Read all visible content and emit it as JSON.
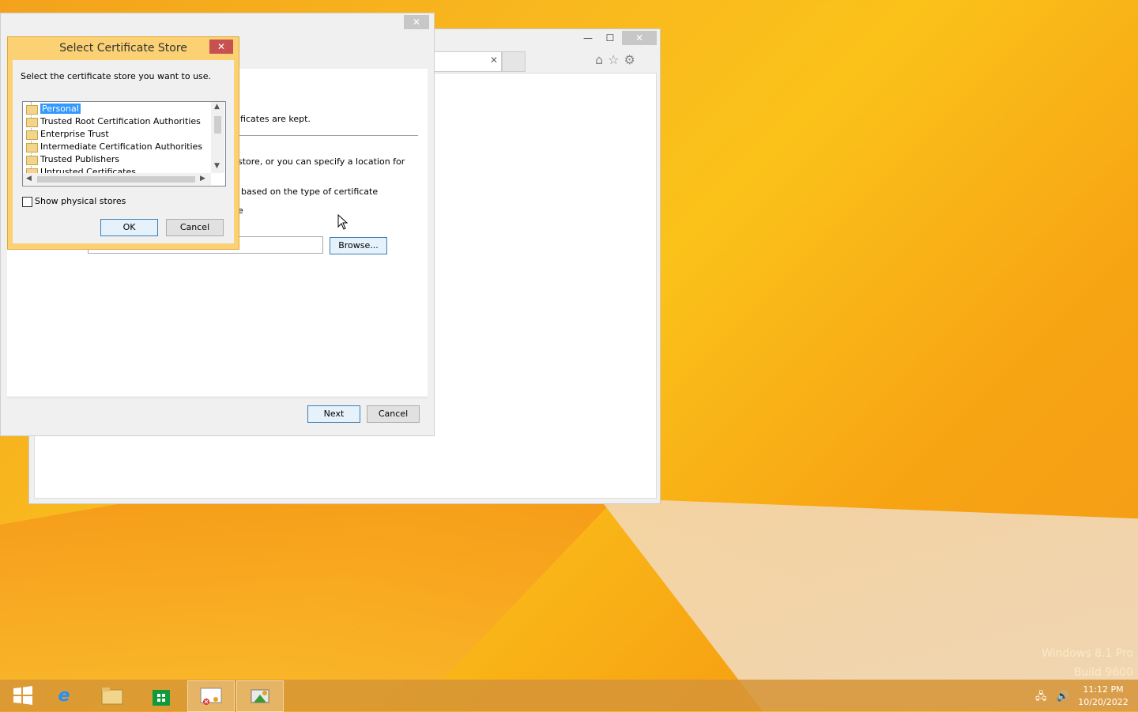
{
  "wizard": {
    "close_glyph": "✕",
    "snippet_kept": "ificates are kept.",
    "snippet_store": "store, or you can specify a location for",
    "snippet_type": "based on the type of certificate",
    "snippet_place": "e",
    "browse_label": "Browse...",
    "next_label": "Next",
    "cancel_label": "Cancel"
  },
  "ie": {
    "min_glyph": "—",
    "max_glyph": "☐",
    "close_glyph": "✕",
    "tab_close_glyph": "✕",
    "toolbar_icons": "⌂☆⚙"
  },
  "dialog": {
    "title": "Select Certificate Store",
    "close_glyph": "✕",
    "prompt": "Select the certificate store you want to use.",
    "stores": [
      "Personal",
      "Trusted Root Certification Authorities",
      "Enterprise Trust",
      "Intermediate Certification Authorities",
      "Trusted Publishers",
      "Untrusted Certificates"
    ],
    "selected_store": "Personal",
    "show_physical_label": "Show physical stores",
    "show_physical_checked": false,
    "ok_label": "OK",
    "cancel_label": "Cancel"
  },
  "taskbar": {
    "items": [
      "start-icon",
      "internet-explorer-icon",
      "file-explorer-icon",
      "store-icon",
      "certificate-manager-icon",
      "certificate-import-wizard-icon"
    ],
    "time": "11:12 PM",
    "date": "10/20/2022"
  },
  "watermark": {
    "line1": "Windows 8.1 Pro",
    "line2": "Build 9600"
  }
}
